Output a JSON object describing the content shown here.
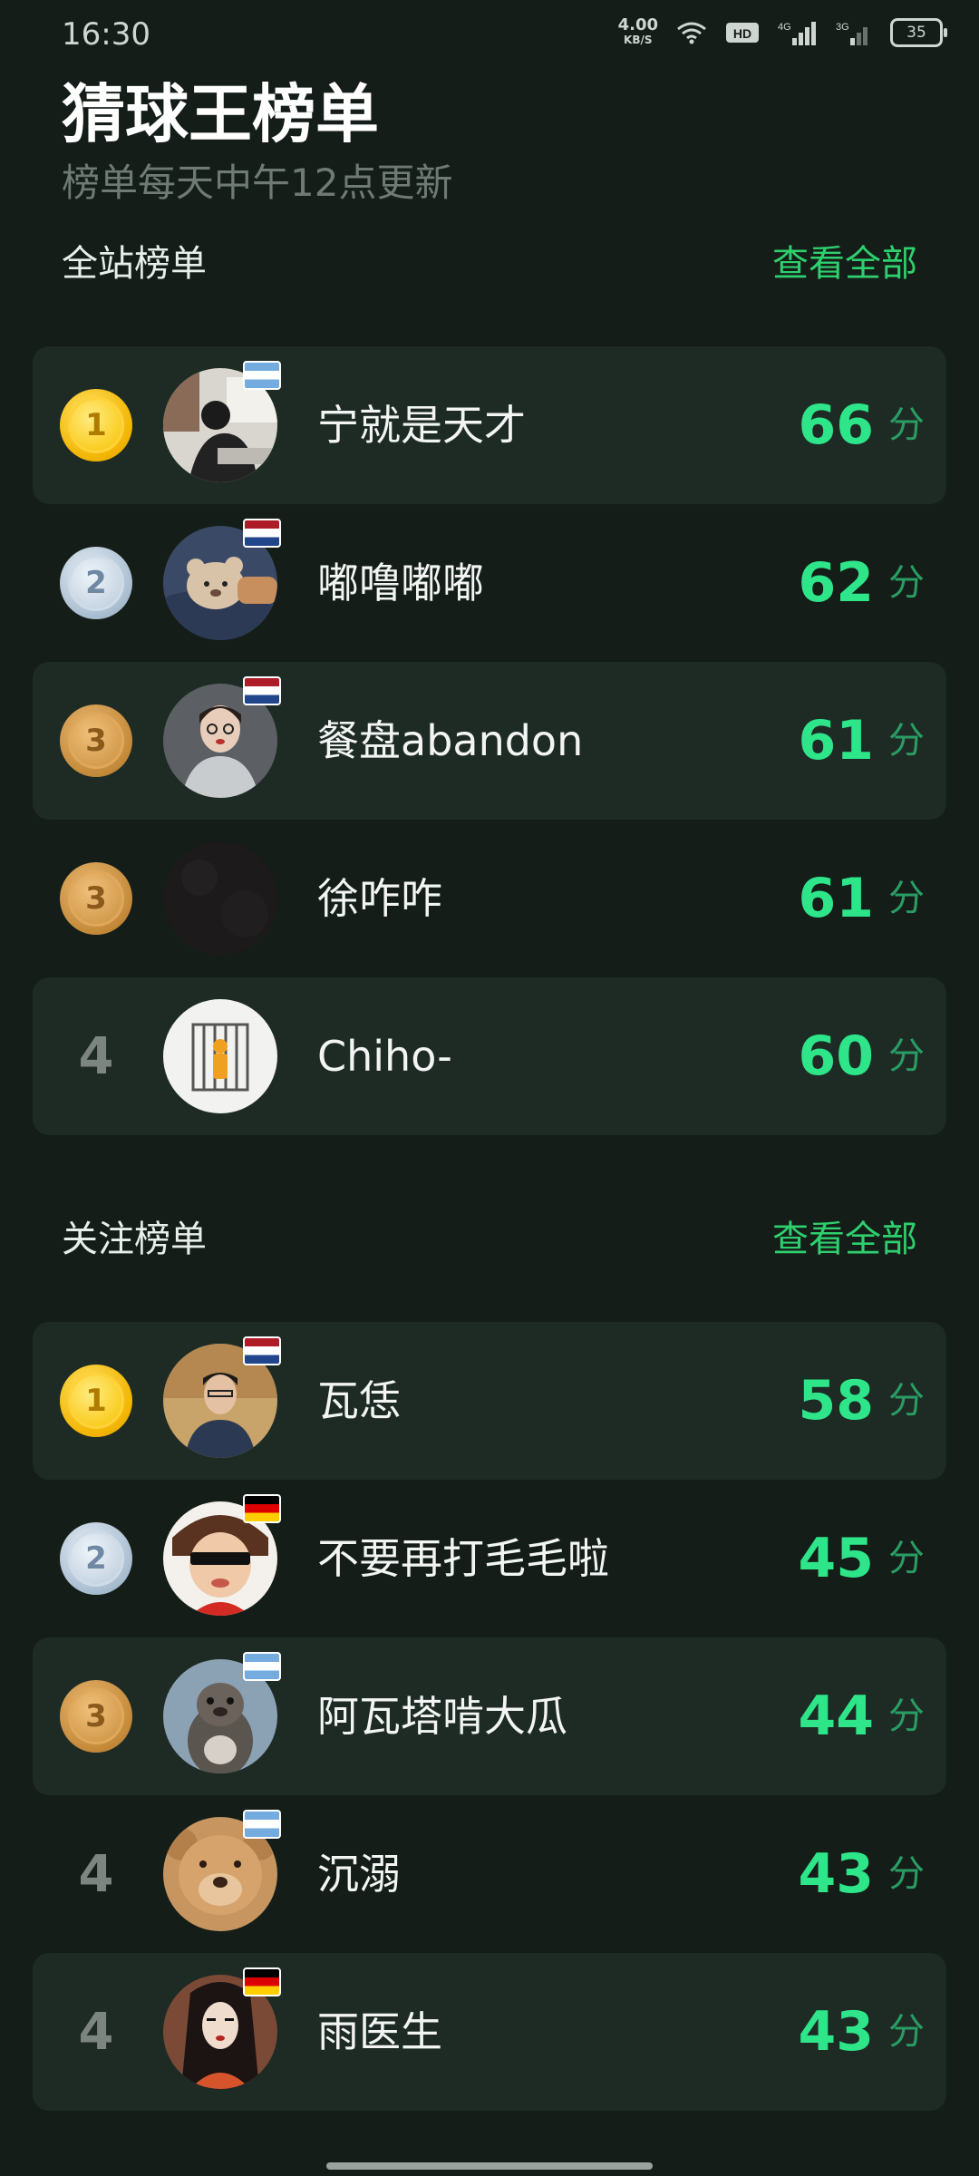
{
  "status_bar": {
    "time": "16:30",
    "net_speed": "4.00",
    "net_unit": "KB/S",
    "battery": "35",
    "icons": [
      "wifi-icon",
      "hd-icon",
      "signal-4g-icon",
      "signal-3g-icon",
      "battery-icon"
    ]
  },
  "header": {
    "title": "猜球王榜单",
    "subtitle": "榜单每天中午12点更新"
  },
  "sections": [
    {
      "title": "全站榜单",
      "view_all": "查看全部",
      "rows": [
        {
          "rank": "1",
          "medal": "gold",
          "name": "宁就是天才",
          "score": "66",
          "unit": "分",
          "flag": "argentina"
        },
        {
          "rank": "2",
          "medal": "silver",
          "name": "嘟噜嘟嘟",
          "score": "62",
          "unit": "分",
          "flag": "netherlands"
        },
        {
          "rank": "3",
          "medal": "bronze",
          "name": "餐盘abandon",
          "score": "61",
          "unit": "分",
          "flag": "netherlands"
        },
        {
          "rank": "3",
          "medal": "bronze",
          "name": "徐咋咋",
          "score": "61",
          "unit": "分",
          "flag": ""
        },
        {
          "rank": "4",
          "medal": "",
          "name": "Chiho-",
          "score": "60",
          "unit": "分",
          "flag": ""
        }
      ]
    },
    {
      "title": "关注榜单",
      "view_all": "查看全部",
      "rows": [
        {
          "rank": "1",
          "medal": "gold",
          "name": "瓦恁",
          "score": "58",
          "unit": "分",
          "flag": "netherlands"
        },
        {
          "rank": "2",
          "medal": "silver",
          "name": "不要再打毛毛啦",
          "score": "45",
          "unit": "分",
          "flag": "germany"
        },
        {
          "rank": "3",
          "medal": "bronze",
          "name": "阿瓦塔啃大瓜",
          "score": "44",
          "unit": "分",
          "flag": "argentina"
        },
        {
          "rank": "4",
          "medal": "",
          "name": "沉溺",
          "score": "43",
          "unit": "分",
          "flag": "argentina"
        },
        {
          "rank": "4",
          "medal": "",
          "name": "雨医生",
          "score": "43",
          "unit": "分",
          "flag": "germany"
        }
      ]
    }
  ]
}
